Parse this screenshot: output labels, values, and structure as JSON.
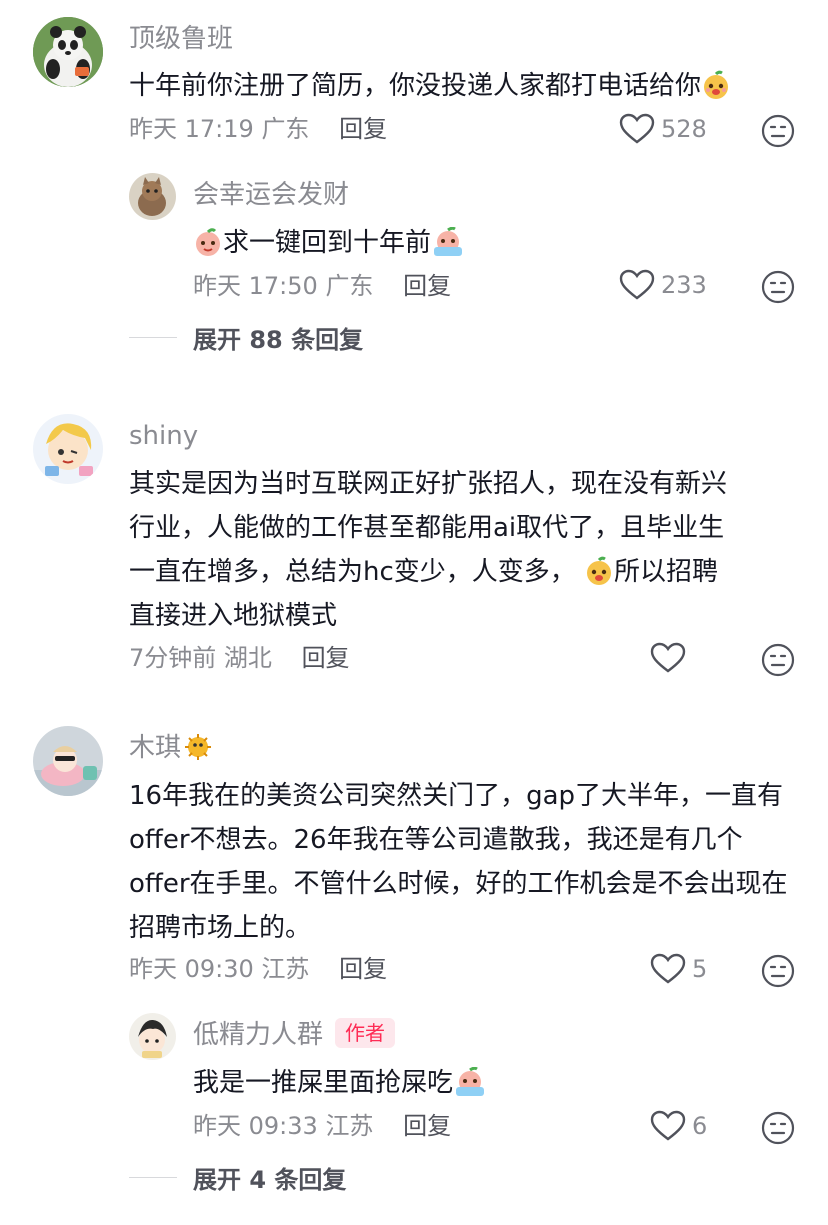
{
  "comments": [
    {
      "username": "顶级鲁班",
      "text": "十年前你注册了简历，你没投递人家都打电话给你",
      "time": "昨天 17:19",
      "location": "广东",
      "reply_label": "回复",
      "likes": "528",
      "replies": [
        {
          "username": "会幸运会发财",
          "text": "求一键回到十年前",
          "time": "昨天 17:50",
          "location": "广东",
          "reply_label": "回复",
          "likes": "233"
        }
      ],
      "expand_label": "展开 88 条回复"
    },
    {
      "username": "shiny",
      "text_lines": [
        "其实是因为当时互联网正好扩张招人，现在没有新兴",
        "行业，人能做的工作甚至都能用ai取代了，且毕业生",
        "一直在增多，总结为hc变少，人变多，",
        "所以招聘",
        "直接进入地狱模式"
      ],
      "time": "7分钟前",
      "location": "湖北",
      "reply_label": "回复",
      "likes": ""
    },
    {
      "username": "木琪",
      "text": "16年我在的美资公司突然关门了，gap了大半年，一直有offer不想去。26年我在等公司遣散我，我还是有几个offer在手里。不管什么时候，好的工作机会是不会出现在招聘市场上的。",
      "time": "昨天 09:30",
      "location": "江苏",
      "reply_label": "回复",
      "likes": "5",
      "replies": [
        {
          "username": "低精力人群",
          "author_tag": "作者",
          "text": "我是一推屎里面抢屎吃",
          "time": "昨天 09:33",
          "location": "江苏",
          "reply_label": "回复",
          "likes": "6"
        }
      ],
      "expand_label": "展开 4 条回复"
    }
  ]
}
